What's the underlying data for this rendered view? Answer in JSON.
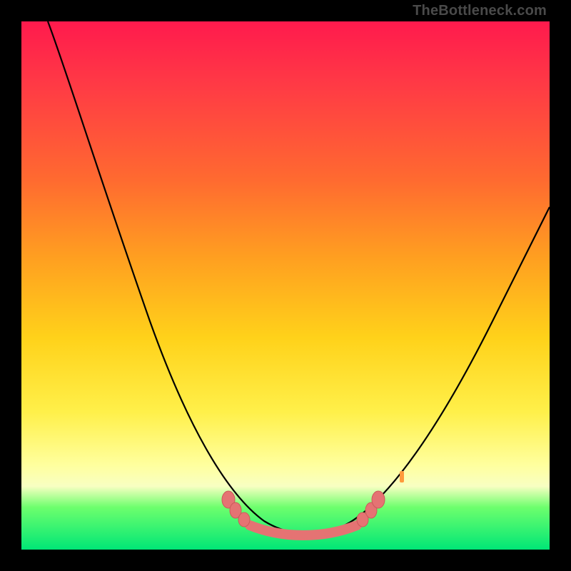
{
  "watermark": "TheBottleneck.com",
  "colors": {
    "frame": "#000000",
    "curve_stroke": "#000000",
    "marker_fill": "#e57373",
    "marker_stroke": "#cc5a5a",
    "gradient_stops": [
      "#ff1a4d",
      "#ff3a45",
      "#ff6a30",
      "#ffa020",
      "#ffd21a",
      "#fff04a",
      "#ffff9e",
      "#f8ffc2",
      "#6dff6d",
      "#00e676"
    ]
  },
  "chart_data": {
    "type": "line",
    "title": "",
    "xlabel": "",
    "ylabel": "",
    "xlim": [
      0,
      100
    ],
    "ylim": [
      0,
      100
    ],
    "grid": false,
    "legend": false,
    "series": [
      {
        "name": "bottleneck-curve",
        "x": [
          5,
          10,
          15,
          20,
          25,
          30,
          35,
          38,
          42,
          45,
          48,
          50,
          52,
          55,
          58,
          62,
          65,
          70,
          75,
          80,
          85,
          90,
          95,
          100
        ],
        "y": [
          100,
          88,
          76,
          64,
          52,
          40,
          28,
          20,
          12,
          8,
          5,
          4,
          4,
          4,
          5,
          8,
          12,
          20,
          28,
          36,
          44,
          50,
          56,
          62
        ]
      }
    ],
    "markers": {
      "name": "highlighted-points",
      "x": [
        42,
        44,
        47,
        49,
        51,
        53,
        55,
        57,
        60,
        62,
        64
      ],
      "y": [
        14,
        10,
        6,
        4.5,
        4,
        4,
        4,
        4.5,
        6,
        10,
        14
      ]
    }
  }
}
